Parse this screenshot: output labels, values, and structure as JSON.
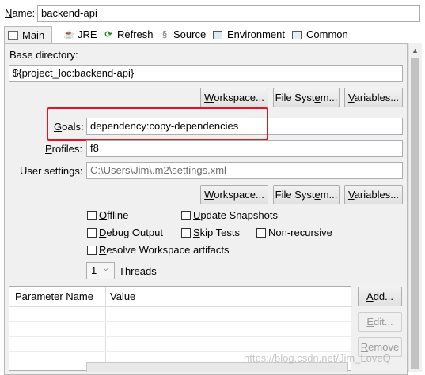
{
  "name_row": {
    "label": "Name:",
    "value": "backend-api"
  },
  "tabs": [
    {
      "label": "Main",
      "icon": "main-icon"
    },
    {
      "label": "JRE",
      "icon": "jre-icon"
    },
    {
      "label": "Refresh",
      "icon": "refresh-icon"
    },
    {
      "label": "Source",
      "icon": "source-icon"
    },
    {
      "label": "Environment",
      "icon": "environment-icon"
    },
    {
      "label": "Common",
      "icon": "common-icon"
    }
  ],
  "main": {
    "base_directory": {
      "label": "Base directory:",
      "value": "${project_loc:backend-api}"
    },
    "buttons_row1": {
      "workspace": "Workspace...",
      "file_system": "File System...",
      "variables": "Variables..."
    },
    "goals": {
      "label": "Goals:",
      "value": "dependency:copy-dependencies"
    },
    "profiles": {
      "label": "Profiles:",
      "value": "f8"
    },
    "user_settings": {
      "label": "User settings:",
      "value": "C:\\Users\\Jim\\.m2\\settings.xml"
    },
    "buttons_row2": {
      "workspace": "Workspace...",
      "file_system": "File System...",
      "variables": "Variables..."
    },
    "options": {
      "offline": "Offline",
      "update_snapshots": "Update Snapshots",
      "debug_output": "Debug Output",
      "skip_tests": "Skip Tests",
      "non_recursive": "Non-recursive",
      "resolve_workspace": "Resolve Workspace artifacts"
    },
    "threads": {
      "value": "1",
      "label": "Threads"
    },
    "params_table": {
      "columns": [
        "Parameter Name",
        "Value"
      ]
    },
    "param_buttons": {
      "add": "Add...",
      "edit": "Edit...",
      "remove": "Remove"
    }
  },
  "watermark": "https://blog.csdn.net/Jim_LoveQ",
  "colors": {
    "highlight": "#e81123",
    "panel_bg": "#f0f0f0",
    "border": "#abadb3"
  }
}
